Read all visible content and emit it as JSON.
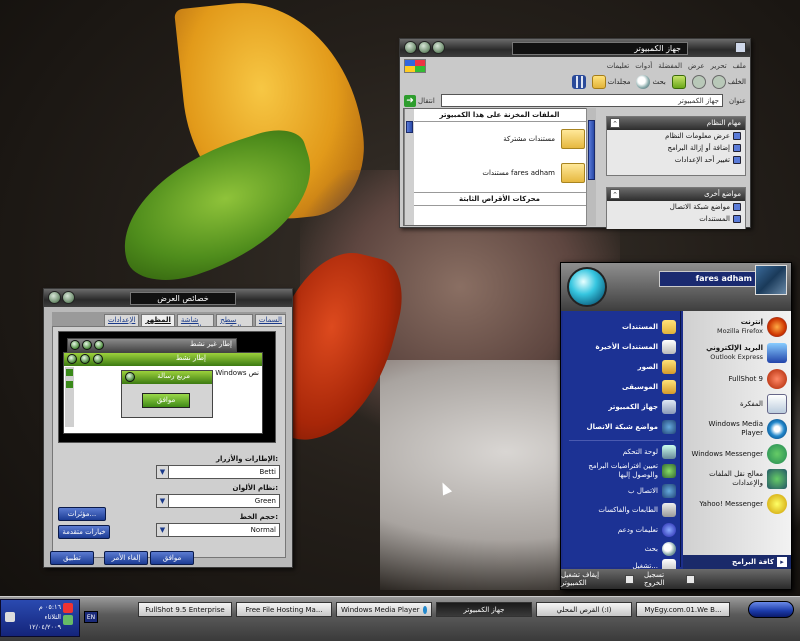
{
  "explorer": {
    "title": "جهاز الكمبيوتر",
    "menu": [
      "ملف",
      "تحرير",
      "عرض",
      "المفضلة",
      "أدوات",
      "تعليمات"
    ],
    "back_label": "الخلف",
    "search_label": "بحث",
    "folders_label": "مجلدات",
    "address_label": "عنوان",
    "address_value": "جهاز الكمبيوتر",
    "go_label": "انتقال",
    "section_shared": "الملفات المخزنة على هذا الكمبيوتر",
    "items": [
      "مستندات مشتركة",
      "مستندات fares adham"
    ],
    "section_drives": "محركات الأقراص الثابتة",
    "system_tasks": {
      "title": "مهام النظام",
      "items": [
        "عرض معلومات النظام",
        "إضافة أو إزالة البرامج",
        "تغيير أحد الإعدادات"
      ]
    },
    "other_places": {
      "title": "مواضع أخرى",
      "items": [
        "مواضع شبكة الاتصال",
        "المستندات"
      ]
    }
  },
  "display": {
    "title": "خصائص العرض",
    "tabs": [
      "السمات",
      "سطح المكتب",
      "شاشة التوقف",
      "المظهر",
      "الإعدادات"
    ],
    "active_tab": "المظهر",
    "preview": {
      "inactive_title": "إطار غير نشط",
      "active_title": "إطار نشط",
      "msg_title": "مربع رسالة",
      "window_text": "Windows",
      "side_text": "نص",
      "ok": "موافق"
    },
    "windows_buttons_label": "الإطارات والأزرار:",
    "windows_buttons_value": "Betti",
    "color_scheme_label": "نظام الألوان:",
    "color_scheme_value": "Green",
    "font_size_label": "حجم الخط:",
    "font_size_value": "Normal",
    "effects_button": "مؤثرات...",
    "advanced_button": "خيارات متقدمة",
    "ok_button": "موافق",
    "cancel_button": "إلغاء الأمر",
    "apply_button": "تطبيق"
  },
  "start_menu": {
    "user": "fares adham",
    "right_items": [
      {
        "title": "إنترنت",
        "sub": "Mozilla Firefox"
      },
      {
        "title": "البريد الإلكتروني",
        "sub": "Outlook Express"
      },
      {
        "title": "FullShot 9",
        "sub": ""
      },
      {
        "title": "المفكرة",
        "sub": ""
      },
      {
        "title": "Windows Media Player",
        "sub": ""
      },
      {
        "title": "Windows Messenger",
        "sub": ""
      },
      {
        "title": "معالج نقل الملفات والإعدادات",
        "sub": ""
      },
      {
        "title": "Yahoo! Messenger",
        "sub": ""
      }
    ],
    "left_items": [
      "المستندات",
      "المستندات الأخيرة",
      "الصور",
      "الموسيقى",
      "جهاز الكمبيوتر",
      "مواضع شبكة الاتصال",
      "لوحة التحكم",
      "تعيين افتراضيات البرامج والوصول إليها",
      "الاتصال ب",
      "الطابعات والفاكسات",
      "تعليمات ودعم",
      "بحث",
      "تشغيل..."
    ],
    "all_programs": "كافة البرامج",
    "logoff": "تسجيل الخروج",
    "shutdown": "إيقاف تشغيل الكمبيوتر"
  },
  "taskbar": {
    "buttons": [
      "FullShot 9.5 Enterprise",
      "Free File Hosting Ma...",
      "Windows Media Player",
      "جهاز الكمبيوتر",
      "القرص المحلي (:I)",
      "MyEgy.com.01.We B..."
    ],
    "lang": "EN",
    "tray_time": "٠٥:١٦ م",
    "tray_day": "الثلاثاء",
    "tray_date": "١٢/٠٤/٢٠٠٩"
  },
  "colors": {
    "start_blue": "#1c3294",
    "accent_green": "#5aa82a",
    "chrome_gray": "#c9c9c9"
  }
}
